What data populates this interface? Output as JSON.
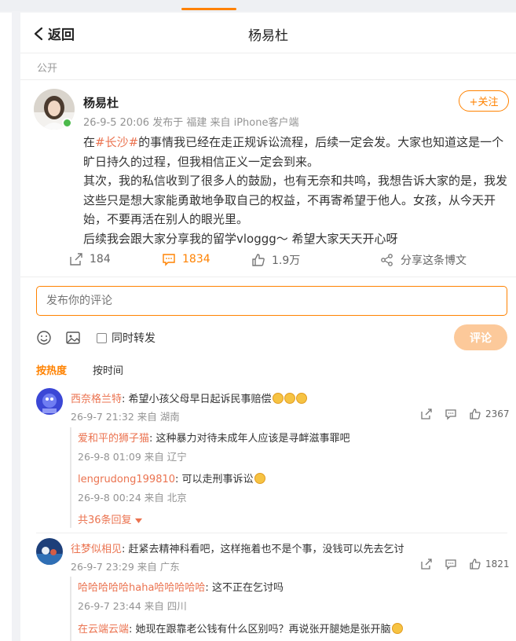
{
  "header": {
    "back_label": "返回",
    "title": "杨易杜"
  },
  "post": {
    "visibility": "公开",
    "author": "杨易杜",
    "meta": "26-9-5 20:06 发布于 福建 来自 iPhone客户端",
    "follow_label": "+关注",
    "body": {
      "p1_before": "在",
      "hashtag": "#长沙#",
      "p1_after": "的事情我已经在走正规诉讼流程，后续一定会发。大家也知道这是一个旷日持久的过程，但我相信正义一定会到来。",
      "p2": "其次，我的私信收到了很多人的鼓励，也有无奈和共鸣，我想告诉大家的是，我发这些只是想大家能勇敢地争取自己的权益，不再寄希望于他人。女孩，从今天开始，不要再活在别人的眼光里。",
      "p3": "后续我会跟大家分享我的留学vloggg～ 希望大家天天开心呀"
    },
    "stats": {
      "reposts": "184",
      "comments": "1834",
      "likes": "1.9万",
      "share_label": "分享这条博文"
    }
  },
  "composer": {
    "placeholder": "发布你的评论",
    "repost_label": "同时转发",
    "submit_label": "评论"
  },
  "sort": {
    "hot": "按热度",
    "time": "按时间"
  },
  "comments": [
    {
      "user": "西奈格兰特",
      "text": "希望小孩父母早日起诉民事赔偿",
      "meta": "26-9-7 21:32 来自 湖南",
      "likes": "2367",
      "replies": [
        {
          "user": "爱和平的狮子猫",
          "text": "这种暴力对待未成年人应该是寻衅滋事罪吧",
          "meta": "26-9-8 01:09 来自 辽宁"
        },
        {
          "user": "lengrudong199810",
          "text": "可以走刑事诉讼",
          "meta": "26-9-8 00:24 来自 北京"
        }
      ],
      "more_label": "共36条回复"
    },
    {
      "user": "往梦似相见",
      "text": "赶紧去精神科看吧，这样拖着也不是个事，没钱可以先去乞讨",
      "meta": "26-9-7 23:29 来自 广东",
      "likes": "1821",
      "replies": [
        {
          "user": "哈哈哈哈哈haha哈哈哈哈哈",
          "text": "这不正在乞讨吗",
          "meta": "26-9-7 23:44 来自 四川"
        },
        {
          "user": "在云端云端",
          "text": "她现在跟靠老公钱有什么区别吗？再说张开腿她是张开脑"
        }
      ]
    }
  ],
  "colors": {
    "accent": "#ff8200",
    "link": "#eb7350"
  },
  "icons": [
    "chevron-left-icon",
    "repost-icon",
    "comment-icon",
    "like-icon",
    "share-icon",
    "emoji-icon",
    "image-icon"
  ]
}
